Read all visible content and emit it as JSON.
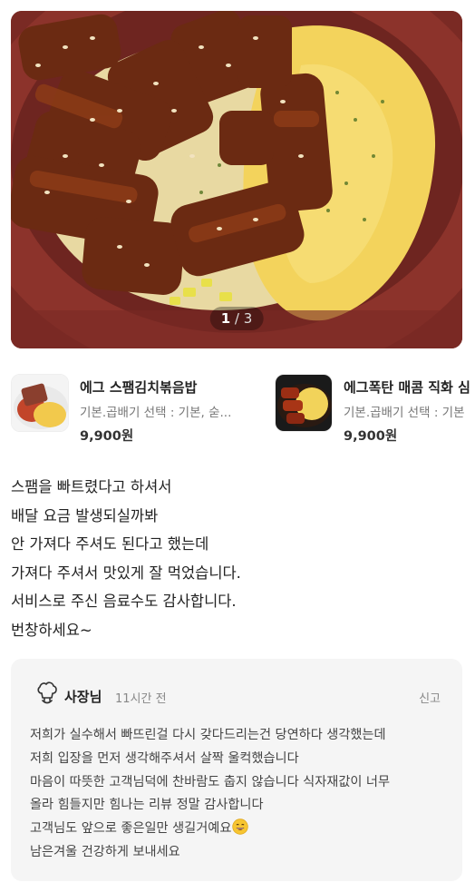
{
  "gallery": {
    "current": "1",
    "separator": "/",
    "total": "3"
  },
  "menus": [
    {
      "name": "에그 스팸김치볶음밥",
      "options": "기본.곱배기 선택 : 기본, 숟...",
      "price": "9,900원",
      "thumb_icon": "spam-kimchi-fried-rice-thumbnail"
    },
    {
      "name": "에그폭탄 매콤 직화 심",
      "options": "기본.곱배기 선택 : 기본",
      "price": "9,900원",
      "thumb_icon": "spicy-grilled-pork-egg-bowl-thumbnail"
    }
  ],
  "review": {
    "lines": [
      "스팸을 빠트렸다고 하셔서",
      "배달 요금 발생되실까봐",
      "안 가져다 주셔도 된다고 했는데",
      "가져다 주셔서 맛있게 잘 먹었습니다.",
      "서비스로 주신 음료수도 감사합니다.",
      "번창하세요~"
    ]
  },
  "owner_reply": {
    "author": "사장님",
    "time": "11시간 전",
    "report_label": "신고",
    "icon": "chef-hat-icon",
    "lines": [
      "저희가 실수해서 빠뜨린걸 다시 갖다드리는건 당연하다 생각했는데",
      "저희 입장을 먼저 생각해주셔서 살짝 울컥했습니다",
      "마음이 따뜻한 고객님덕에 찬바람도 춥지 않습니다 식자재값이 너무",
      "올라 힘들지만 힘나는 리뷰 정말 감사합니다",
      "고객님도 앞으로 좋은일만 생길거예요",
      "남은겨울 건강하게 보내세요"
    ],
    "emoji": "grinning-face-emoji"
  },
  "colors": {
    "photo_bowl": "#7a2a24",
    "egg": "#f3d35c",
    "meat": "#6b2a12",
    "reply_bg": "#f5f5f5",
    "muted_text": "#888888"
  }
}
